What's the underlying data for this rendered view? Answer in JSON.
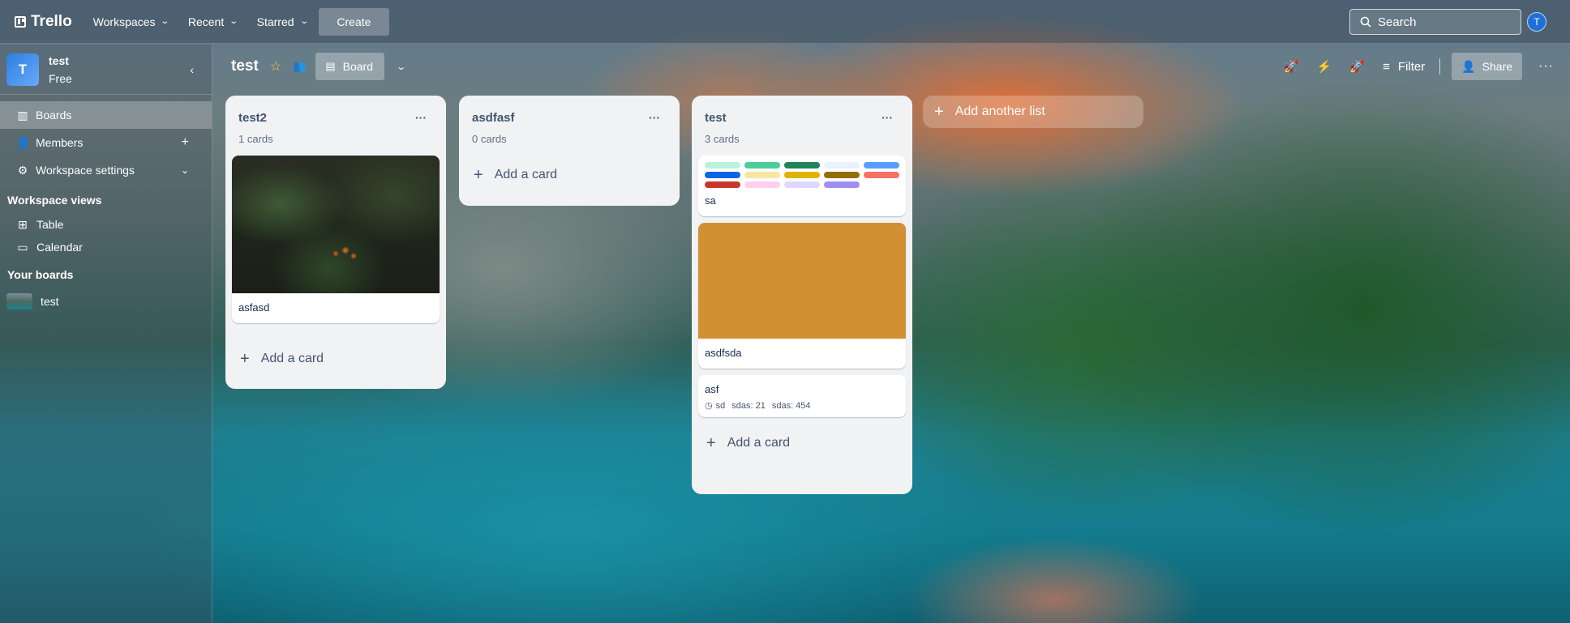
{
  "topbar": {
    "brand": "Trello",
    "nav": [
      "Workspaces",
      "Recent",
      "Starred"
    ],
    "create_label": "Create",
    "search_placeholder": "Search",
    "avatar_initial": "T"
  },
  "sidebar": {
    "workspace_initial": "T",
    "workspace_name": "test",
    "workspace_plan": "Free",
    "items": [
      {
        "label": "Boards",
        "icon": "boards-icon"
      },
      {
        "label": "Members",
        "icon": "members-icon"
      },
      {
        "label": "Workspace settings",
        "icon": "gear-icon"
      }
    ],
    "views_heading": "Workspace views",
    "views": [
      {
        "label": "Table",
        "icon": "table-icon"
      },
      {
        "label": "Calendar",
        "icon": "calendar-icon"
      }
    ],
    "boards_heading": "Your boards",
    "boards": [
      {
        "label": "test"
      }
    ]
  },
  "board": {
    "title": "test",
    "view_label": "Board",
    "filter_label": "Filter",
    "share_label": "Share"
  },
  "lists": [
    {
      "title": "test2",
      "count": "1 cards",
      "cards": [
        {
          "title": "asfasd",
          "cover": "photo"
        }
      ],
      "add_card": "Add a card"
    },
    {
      "title": "asdfasf",
      "count": "0 cards",
      "cards": [],
      "add_card": "Add a card"
    },
    {
      "title": "test",
      "count": "3 cards",
      "cards": [
        {
          "title": "sa",
          "labels": [
            "#baf3db",
            "#4bce97",
            "#1f845a",
            "#e9f2ff",
            "#579dff",
            "#0c66e4",
            "#f8e6a0",
            "#e2b203",
            "#946f00",
            "#f87168",
            "#c9372c",
            "#fdd0ec",
            "#dfd8fd",
            "#9f8fef"
          ]
        },
        {
          "title": "asdfsda",
          "cover_color": "#d29034"
        },
        {
          "title": "asf",
          "badges": [
            "sd",
            "sdas: 21",
            "sdas: 454"
          ]
        }
      ],
      "add_card": "Add a card"
    }
  ],
  "add_list_label": "Add another list"
}
